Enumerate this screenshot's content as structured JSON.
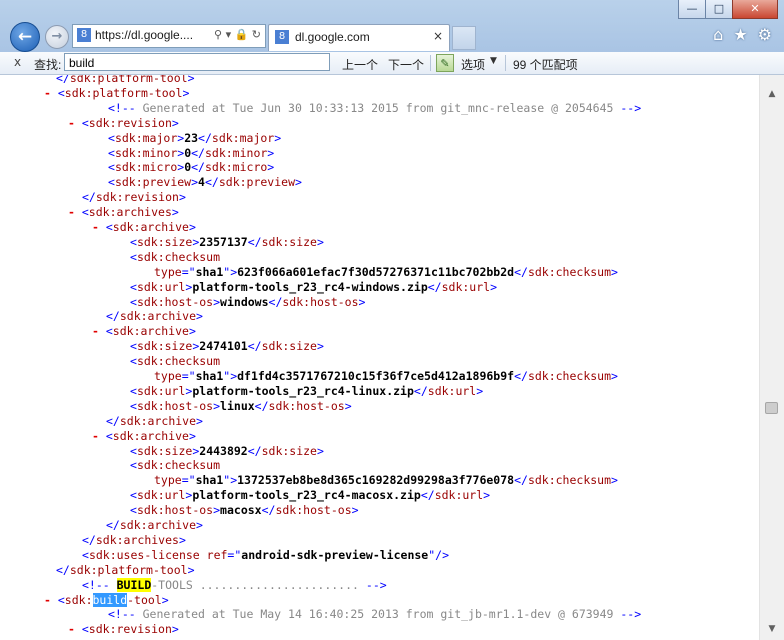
{
  "window": {
    "controls": {
      "minimize": "—",
      "maximize": "□",
      "close": "✕"
    }
  },
  "nav": {
    "back_icon": "←",
    "forward_icon": "→"
  },
  "address_bar": {
    "url": "https://dl.google....",
    "icons": "⚲ ▾ 🔒 ↻",
    "favicon": "8"
  },
  "tab": {
    "title": "dl.google.com",
    "close": "×",
    "favicon": "8"
  },
  "toolbar_icons": {
    "home": "⌂",
    "favorites": "★",
    "settings": "⚙"
  },
  "find_bar": {
    "close": "x",
    "label": "查找:",
    "query": "build",
    "prev": "上一个",
    "next": "下一个",
    "options": "选项",
    "match_count": "99 个匹配项"
  },
  "xml_lines": [
    {
      "indent": 56,
      "parts": [
        {
          "c": "bl",
          "t": "</"
        },
        {
          "c": "tag",
          "t": "sdk:platform-tool"
        },
        {
          "c": "bl",
          "t": ">"
        }
      ]
    },
    {
      "indent": 44,
      "parts": [
        {
          "c": "minus",
          "t": "- "
        },
        {
          "c": "bl",
          "t": "<"
        },
        {
          "c": "tag",
          "t": "sdk:platform-tool"
        },
        {
          "c": "bl",
          "t": ">"
        }
      ]
    },
    {
      "indent": 108,
      "parts": [
        {
          "c": "bl",
          "t": "<!--"
        },
        {
          "c": "cmt",
          "t": " Generated at Tue Jun 30 10:33:13 2015 from git_mnc-release @ 2054645 "
        },
        {
          "c": "bl",
          "t": "-->"
        }
      ]
    },
    {
      "indent": 68,
      "parts": [
        {
          "c": "minus",
          "t": "- "
        },
        {
          "c": "bl",
          "t": "<"
        },
        {
          "c": "tag",
          "t": "sdk:revision"
        },
        {
          "c": "bl",
          "t": ">"
        }
      ]
    },
    {
      "indent": 108,
      "parts": [
        {
          "c": "bl",
          "t": "<"
        },
        {
          "c": "tag",
          "t": "sdk:major"
        },
        {
          "c": "bl",
          "t": ">"
        },
        {
          "c": "val",
          "t": "23"
        },
        {
          "c": "bl",
          "t": "</"
        },
        {
          "c": "tag",
          "t": "sdk:major"
        },
        {
          "c": "bl",
          "t": ">"
        }
      ]
    },
    {
      "indent": 108,
      "parts": [
        {
          "c": "bl",
          "t": "<"
        },
        {
          "c": "tag",
          "t": "sdk:minor"
        },
        {
          "c": "bl",
          "t": ">"
        },
        {
          "c": "val",
          "t": "0"
        },
        {
          "c": "bl",
          "t": "</"
        },
        {
          "c": "tag",
          "t": "sdk:minor"
        },
        {
          "c": "bl",
          "t": ">"
        }
      ]
    },
    {
      "indent": 108,
      "parts": [
        {
          "c": "bl",
          "t": "<"
        },
        {
          "c": "tag",
          "t": "sdk:micro"
        },
        {
          "c": "bl",
          "t": ">"
        },
        {
          "c": "val",
          "t": "0"
        },
        {
          "c": "bl",
          "t": "</"
        },
        {
          "c": "tag",
          "t": "sdk:micro"
        },
        {
          "c": "bl",
          "t": ">"
        }
      ]
    },
    {
      "indent": 108,
      "parts": [
        {
          "c": "bl",
          "t": "<"
        },
        {
          "c": "tag",
          "t": "sdk:preview"
        },
        {
          "c": "bl",
          "t": ">"
        },
        {
          "c": "val",
          "t": "4"
        },
        {
          "c": "bl",
          "t": "</"
        },
        {
          "c": "tag",
          "t": "sdk:preview"
        },
        {
          "c": "bl",
          "t": ">"
        }
      ]
    },
    {
      "indent": 82,
      "parts": [
        {
          "c": "bl",
          "t": "</"
        },
        {
          "c": "tag",
          "t": "sdk:revision"
        },
        {
          "c": "bl",
          "t": ">"
        }
      ]
    },
    {
      "indent": 68,
      "parts": [
        {
          "c": "minus",
          "t": "- "
        },
        {
          "c": "bl",
          "t": "<"
        },
        {
          "c": "tag",
          "t": "sdk:archives"
        },
        {
          "c": "bl",
          "t": ">"
        }
      ]
    },
    {
      "indent": 92,
      "parts": [
        {
          "c": "minus",
          "t": "- "
        },
        {
          "c": "bl",
          "t": "<"
        },
        {
          "c": "tag",
          "t": "sdk:archive"
        },
        {
          "c": "bl",
          "t": ">"
        }
      ]
    },
    {
      "indent": 130,
      "parts": [
        {
          "c": "bl",
          "t": "<"
        },
        {
          "c": "tag",
          "t": "sdk:size"
        },
        {
          "c": "bl",
          "t": ">"
        },
        {
          "c": "val",
          "t": "2357137"
        },
        {
          "c": "bl",
          "t": "</"
        },
        {
          "c": "tag",
          "t": "sdk:size"
        },
        {
          "c": "bl",
          "t": ">"
        }
      ]
    },
    {
      "indent": 130,
      "parts": [
        {
          "c": "bl",
          "t": "<"
        },
        {
          "c": "tag",
          "t": "sdk:checksum"
        }
      ]
    },
    {
      "indent": 154,
      "parts": [
        {
          "c": "attr",
          "t": "type"
        },
        {
          "c": "bl",
          "t": "=\""
        },
        {
          "c": "val",
          "t": "sha1"
        },
        {
          "c": "bl",
          "t": "\">"
        },
        {
          "c": "val",
          "t": "623f066a601efac7f30d57276371c11bc702bb2d"
        },
        {
          "c": "bl",
          "t": "</"
        },
        {
          "c": "tag",
          "t": "sdk:checksum"
        },
        {
          "c": "bl",
          "t": ">"
        }
      ]
    },
    {
      "indent": 130,
      "parts": [
        {
          "c": "bl",
          "t": "<"
        },
        {
          "c": "tag",
          "t": "sdk:url"
        },
        {
          "c": "bl",
          "t": ">"
        },
        {
          "c": "val",
          "t": "platform-tools_r23_rc4-windows.zip"
        },
        {
          "c": "bl",
          "t": "</"
        },
        {
          "c": "tag",
          "t": "sdk:url"
        },
        {
          "c": "bl",
          "t": ">"
        }
      ]
    },
    {
      "indent": 130,
      "parts": [
        {
          "c": "bl",
          "t": "<"
        },
        {
          "c": "tag",
          "t": "sdk:host-os"
        },
        {
          "c": "bl",
          "t": ">"
        },
        {
          "c": "val",
          "t": "windows"
        },
        {
          "c": "bl",
          "t": "</"
        },
        {
          "c": "tag",
          "t": "sdk:host-os"
        },
        {
          "c": "bl",
          "t": ">"
        }
      ]
    },
    {
      "indent": 106,
      "parts": [
        {
          "c": "bl",
          "t": "</"
        },
        {
          "c": "tag",
          "t": "sdk:archive"
        },
        {
          "c": "bl",
          "t": ">"
        }
      ]
    },
    {
      "indent": 92,
      "parts": [
        {
          "c": "minus",
          "t": "- "
        },
        {
          "c": "bl",
          "t": "<"
        },
        {
          "c": "tag",
          "t": "sdk:archive"
        },
        {
          "c": "bl",
          "t": ">"
        }
      ]
    },
    {
      "indent": 130,
      "parts": [
        {
          "c": "bl",
          "t": "<"
        },
        {
          "c": "tag",
          "t": "sdk:size"
        },
        {
          "c": "bl",
          "t": ">"
        },
        {
          "c": "val",
          "t": "2474101"
        },
        {
          "c": "bl",
          "t": "</"
        },
        {
          "c": "tag",
          "t": "sdk:size"
        },
        {
          "c": "bl",
          "t": ">"
        }
      ]
    },
    {
      "indent": 130,
      "parts": [
        {
          "c": "bl",
          "t": "<"
        },
        {
          "c": "tag",
          "t": "sdk:checksum"
        }
      ]
    },
    {
      "indent": 154,
      "parts": [
        {
          "c": "attr",
          "t": "type"
        },
        {
          "c": "bl",
          "t": "=\""
        },
        {
          "c": "val",
          "t": "sha1"
        },
        {
          "c": "bl",
          "t": "\">"
        },
        {
          "c": "val",
          "t": "df1fd4c3571767210c15f36f7ce5d412a1896b9f"
        },
        {
          "c": "bl",
          "t": "</"
        },
        {
          "c": "tag",
          "t": "sdk:checksum"
        },
        {
          "c": "bl",
          "t": ">"
        }
      ]
    },
    {
      "indent": 130,
      "parts": [
        {
          "c": "bl",
          "t": "<"
        },
        {
          "c": "tag",
          "t": "sdk:url"
        },
        {
          "c": "bl",
          "t": ">"
        },
        {
          "c": "val",
          "t": "platform-tools_r23_rc4-linux.zip"
        },
        {
          "c": "bl",
          "t": "</"
        },
        {
          "c": "tag",
          "t": "sdk:url"
        },
        {
          "c": "bl",
          "t": ">"
        }
      ]
    },
    {
      "indent": 130,
      "parts": [
        {
          "c": "bl",
          "t": "<"
        },
        {
          "c": "tag",
          "t": "sdk:host-os"
        },
        {
          "c": "bl",
          "t": ">"
        },
        {
          "c": "val",
          "t": "linux"
        },
        {
          "c": "bl",
          "t": "</"
        },
        {
          "c": "tag",
          "t": "sdk:host-os"
        },
        {
          "c": "bl",
          "t": ">"
        }
      ]
    },
    {
      "indent": 106,
      "parts": [
        {
          "c": "bl",
          "t": "</"
        },
        {
          "c": "tag",
          "t": "sdk:archive"
        },
        {
          "c": "bl",
          "t": ">"
        }
      ]
    },
    {
      "indent": 92,
      "parts": [
        {
          "c": "minus",
          "t": "- "
        },
        {
          "c": "bl",
          "t": "<"
        },
        {
          "c": "tag",
          "t": "sdk:archive"
        },
        {
          "c": "bl",
          "t": ">"
        }
      ]
    },
    {
      "indent": 130,
      "parts": [
        {
          "c": "bl",
          "t": "<"
        },
        {
          "c": "tag",
          "t": "sdk:size"
        },
        {
          "c": "bl",
          "t": ">"
        },
        {
          "c": "val",
          "t": "2443892"
        },
        {
          "c": "bl",
          "t": "</"
        },
        {
          "c": "tag",
          "t": "sdk:size"
        },
        {
          "c": "bl",
          "t": ">"
        }
      ]
    },
    {
      "indent": 130,
      "parts": [
        {
          "c": "bl",
          "t": "<"
        },
        {
          "c": "tag",
          "t": "sdk:checksum"
        }
      ]
    },
    {
      "indent": 154,
      "parts": [
        {
          "c": "attr",
          "t": "type"
        },
        {
          "c": "bl",
          "t": "=\""
        },
        {
          "c": "val",
          "t": "sha1"
        },
        {
          "c": "bl",
          "t": "\">"
        },
        {
          "c": "val",
          "t": "1372537eb8be8d365c169282d99298a3f776e078"
        },
        {
          "c": "bl",
          "t": "</"
        },
        {
          "c": "tag",
          "t": "sdk:checksum"
        },
        {
          "c": "bl",
          "t": ">"
        }
      ]
    },
    {
      "indent": 130,
      "parts": [
        {
          "c": "bl",
          "t": "<"
        },
        {
          "c": "tag",
          "t": "sdk:url"
        },
        {
          "c": "bl",
          "t": ">"
        },
        {
          "c": "val",
          "t": "platform-tools_r23_rc4-macosx.zip"
        },
        {
          "c": "bl",
          "t": "</"
        },
        {
          "c": "tag",
          "t": "sdk:url"
        },
        {
          "c": "bl",
          "t": ">"
        }
      ]
    },
    {
      "indent": 130,
      "parts": [
        {
          "c": "bl",
          "t": "<"
        },
        {
          "c": "tag",
          "t": "sdk:host-os"
        },
        {
          "c": "bl",
          "t": ">"
        },
        {
          "c": "val",
          "t": "macosx"
        },
        {
          "c": "bl",
          "t": "</"
        },
        {
          "c": "tag",
          "t": "sdk:host-os"
        },
        {
          "c": "bl",
          "t": ">"
        }
      ]
    },
    {
      "indent": 106,
      "parts": [
        {
          "c": "bl",
          "t": "</"
        },
        {
          "c": "tag",
          "t": "sdk:archive"
        },
        {
          "c": "bl",
          "t": ">"
        }
      ]
    },
    {
      "indent": 82,
      "parts": [
        {
          "c": "bl",
          "t": "</"
        },
        {
          "c": "tag",
          "t": "sdk:archives"
        },
        {
          "c": "bl",
          "t": ">"
        }
      ]
    },
    {
      "indent": 82,
      "parts": [
        {
          "c": "bl",
          "t": "<"
        },
        {
          "c": "tag",
          "t": "sdk:uses-license"
        },
        {
          "c": "attr",
          "t": " ref"
        },
        {
          "c": "bl",
          "t": "=\""
        },
        {
          "c": "val",
          "t": "android-sdk-preview-license"
        },
        {
          "c": "bl",
          "t": "\"/>"
        }
      ]
    },
    {
      "indent": 56,
      "parts": [
        {
          "c": "bl",
          "t": "</"
        },
        {
          "c": "tag",
          "t": "sdk:platform-tool"
        },
        {
          "c": "bl",
          "t": ">"
        }
      ]
    },
    {
      "indent": 82,
      "parts": [
        {
          "c": "bl",
          "t": "<!-- "
        },
        {
          "c": "hl-y",
          "t": "BUILD"
        },
        {
          "c": "cmt",
          "t": "-TOOLS ....................... "
        },
        {
          "c": "bl",
          "t": "-->"
        }
      ]
    },
    {
      "indent": 44,
      "parts": [
        {
          "c": "minus",
          "t": "- "
        },
        {
          "c": "bl",
          "t": "<"
        },
        {
          "c": "tag",
          "t": "sdk:"
        },
        {
          "c": "hl-b",
          "t": "build"
        },
        {
          "c": "tag",
          "t": "-tool"
        },
        {
          "c": "bl",
          "t": ">"
        }
      ]
    },
    {
      "indent": 108,
      "parts": [
        {
          "c": "bl",
          "t": "<!--"
        },
        {
          "c": "cmt",
          "t": " Generated at Tue May 14 16:40:25 2013 from git_jb-mr1.1-dev @ 673949 "
        },
        {
          "c": "bl",
          "t": "-->"
        }
      ]
    },
    {
      "indent": 68,
      "parts": [
        {
          "c": "minus",
          "t": "- "
        },
        {
          "c": "bl",
          "t": "<"
        },
        {
          "c": "tag",
          "t": "sdk:revision"
        },
        {
          "c": "bl",
          "t": ">"
        }
      ]
    }
  ],
  "scrollbar": {
    "up": "▲",
    "down": "▼"
  }
}
